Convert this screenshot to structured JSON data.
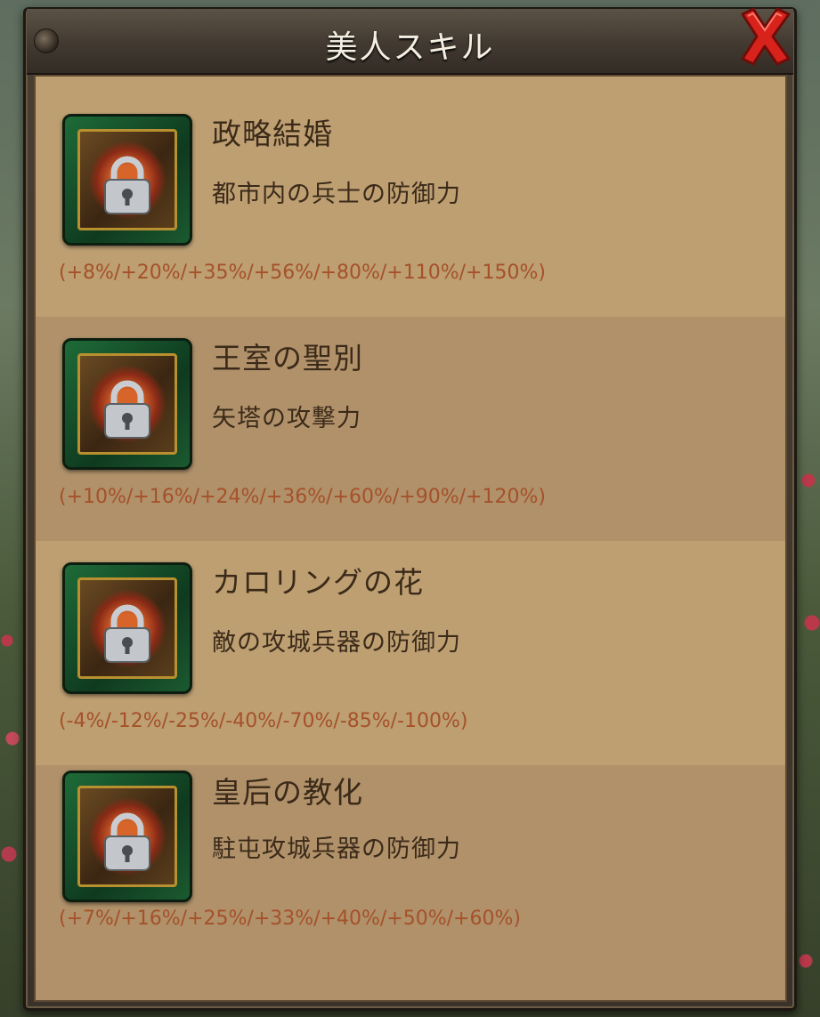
{
  "dialog": {
    "title": "美人スキル",
    "close_icon": "close-x-icon"
  },
  "skills": [
    {
      "name": "政略結婚",
      "description": "都市内の兵士の防御力",
      "values": "(+8%/+20%/+35%/+56%/+80%/+110%/+150%)",
      "icon": "locked-skill-book-icon",
      "locked": true
    },
    {
      "name": "王室の聖別",
      "description": "矢塔の攻撃力",
      "values": "(+10%/+16%/+24%/+36%/+60%/+90%/+120%)",
      "icon": "locked-skill-book-icon",
      "locked": true
    },
    {
      "name": "カロリングの花",
      "description": "敵の攻城兵器の防御力",
      "values": "(-4%/-12%/-25%/-40%/-70%/-85%/-100%)",
      "icon": "locked-skill-book-icon",
      "locked": true
    },
    {
      "name": "皇后の教化",
      "description": "駐屯攻城兵器の防御力",
      "values": "(+7%/+16%/+25%/+33%/+40%/+50%/+60%)",
      "icon": "locked-skill-book-icon",
      "locked": true
    }
  ],
  "colors": {
    "parchment": "#bd9f72",
    "parchment_alt": "#b0916a",
    "text_dark": "#3b2a19",
    "value_text": "#a5512a",
    "close_red": "#d8231c"
  }
}
